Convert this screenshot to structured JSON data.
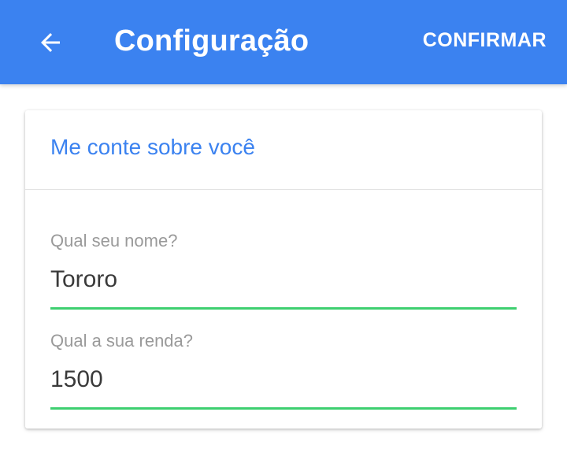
{
  "app_bar": {
    "title": "Configuração",
    "back_icon": "arrow-left-icon",
    "confirm_label": "CONFIRMAR",
    "background_color": "#3b82f0"
  },
  "card": {
    "title": "Me conte sobre você",
    "title_color": "#3b82f0",
    "fields": [
      {
        "label": "Qual seu nome?",
        "value": "Tororo"
      },
      {
        "label": "Qual a sua renda?",
        "value": "1500"
      }
    ],
    "underline_color": "#3ecf70"
  }
}
